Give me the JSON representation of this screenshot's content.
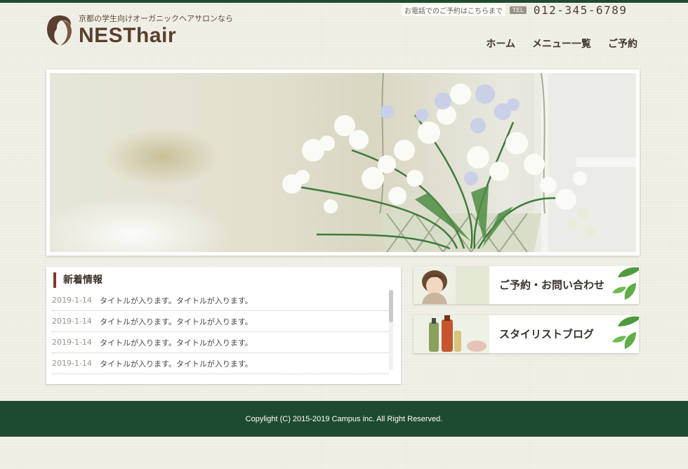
{
  "header": {
    "tagline": "京都の学生向けオーガニックヘアサロンなら",
    "brand": "NESThair",
    "contact_text": "お電話でのご予約はこちらまで",
    "tel_badge": "TEL",
    "phone": "012-345-6789"
  },
  "nav": {
    "items": [
      {
        "label": "ホーム"
      },
      {
        "label": "メニュー一覧"
      },
      {
        "label": "ご予約"
      }
    ]
  },
  "news": {
    "title": "新着情報",
    "items": [
      {
        "date": "2019-1-14",
        "text": "タイトルが入ります。タイトルが入ります。"
      },
      {
        "date": "2019-1-14",
        "text": "タイトルが入ります。タイトルが入ります。"
      },
      {
        "date": "2019-1-14",
        "text": "タイトルが入ります。タイトルが入ります。"
      },
      {
        "date": "2019-1-14",
        "text": "タイトルが入ります。タイトルが入ります。"
      }
    ]
  },
  "banners": [
    {
      "label": "ご予約・お問い合わせ"
    },
    {
      "label": "スタイリストブログ"
    }
  ],
  "footer": {
    "copyright": "Copylight (C) 2015-2019 Campus inc. All Right Reserved."
  },
  "colors": {
    "header_footer_green": "#1f4a32",
    "brand_brown": "#5b3f2e",
    "accent_brown": "#7a3b28"
  }
}
